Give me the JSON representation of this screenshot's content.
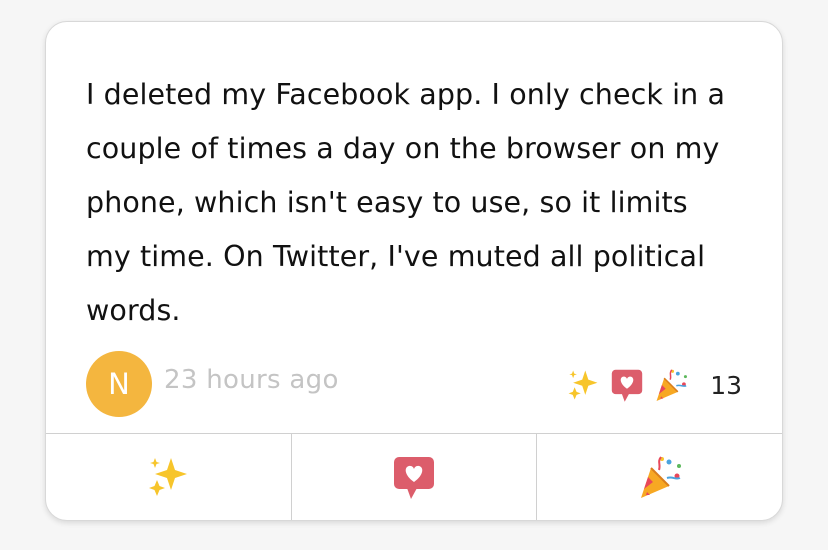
{
  "post": {
    "text": "I deleted my Facebook app. I only check in a couple of times a day on the browser on my phone, which isn't easy to use, so it limits my time. On Twitter, I've muted all political words.",
    "author_initial": "N",
    "timestamp": "23 hours ago"
  },
  "reactions": {
    "icons": [
      "sparkles-icon",
      "heart-speech-bubble-icon",
      "party-popper-icon"
    ],
    "count": "13"
  },
  "actions": [
    {
      "icon": "sparkles-icon"
    },
    {
      "icon": "heart-speech-bubble-icon"
    },
    {
      "icon": "party-popper-icon"
    }
  ],
  "colors": {
    "avatar": "#f4b63f",
    "sparkle": "#f7c52b",
    "heart_bubble": "#dc5d6b",
    "timestamp": "#c4c4c4"
  }
}
